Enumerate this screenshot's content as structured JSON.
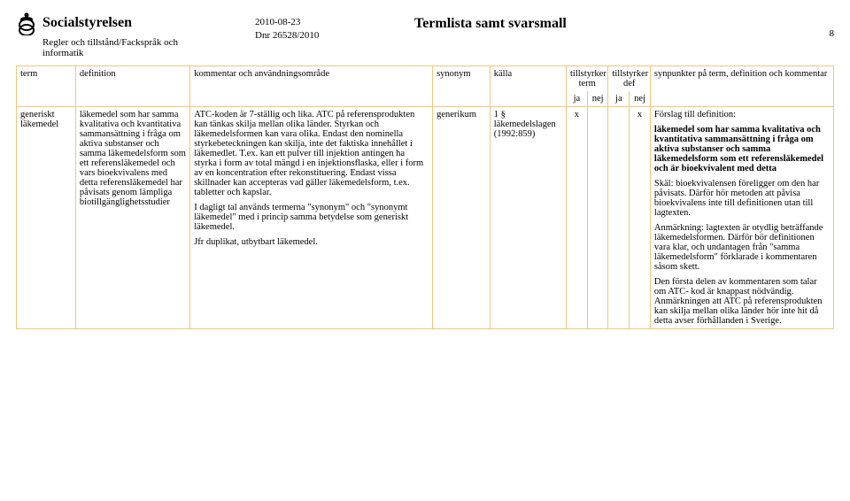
{
  "header": {
    "agency": "Socialstyrelsen",
    "subunit": "Regler och tillstånd/Fackspråk och informatik",
    "date": "2010-08-23",
    "dnr": "Dnr 26528/2010",
    "title": "Termlista samt svarsmall",
    "page": "8"
  },
  "columns": {
    "term": "term",
    "definition": "definition",
    "kommentar": "kommentar och användningsområde",
    "synonym": "synonym",
    "kalla": "källa",
    "tillstyrker_term": "tillstyrker term",
    "tillstyrker_def": "tillstyrker def",
    "ja1": "ja",
    "nej1": "nej",
    "ja2": "ja",
    "nej2": "nej",
    "synpunkter": "synpunkter på term, definition och kommentar"
  },
  "row": {
    "term": "generiskt läkemedel",
    "definition": "läkemedel som har samma kvalitativa och kvantitativa sammansättning i fråga om aktiva substanser och samma läkemedelsform som ett referensläkemedel och vars bioekvivalens med detta referensläkemedel har påvisats genom lämpliga biotillgänglighetsstudier",
    "kommentar_p1": "ATC-koden är 7-ställig och lika. ATC på referensprodukten kan tänkas skilja mellan olika länder. Styrkan och läkemedelsformen kan vara olika. Endast den nominella styrkebeteckningen kan skilja, inte det faktiska innehållet i läkemedlet. T.ex. kan ett pulver till injektion antingen ha styrka i form av total mängd i en injektionsflaska, eller i form av en koncentration efter rekonstituering. Endast vissa skillnader kan accepteras vad gäller läkemedelsform, t.ex. tabletter och kapslar.",
    "kommentar_p2": "I dagligt tal används termerna \"synonym\" och \"synonymt läkemedel\" med i princip samma betydelse som generiskt läkemedel.",
    "kommentar_p3": "Jfr duplikat, utbytbart läkemedel.",
    "synonym": "generikum",
    "kalla": "1 § läkemedelslagen (1992:859)",
    "term_ja": "x",
    "term_nej": "",
    "def_ja": "",
    "def_nej": "x",
    "synpunkter_p1": "Förslag till definition:",
    "synpunkter_p2_bold": "läkemedel som har samma kvalitativa och kvantitativa sammansättning i fråga om aktiva substanser och samma läkemedelsform som ett referensläkemedel och är bioekvivalent med detta",
    "synpunkter_p3": "Skäl: bioekvivalensen föreligger om den har påvisats. Därför hör metoden att påvisa bioekvivalens inte till definitionen utan till lagtexten.",
    "synpunkter_p4": "Anmärkning: lagtexten är otydlig beträffande läkemedelsformen. Därför bör definitionen vara klar, och undantagen från \"samma läkemedelsform\" förklarade i kommentaren såsom skett.",
    "synpunkter_p5": "Den första delen av kommentaren som talar om ATC- kod är knappast nödvändig. Anmärkningen att ATC på referensprodukten kan skilja mellan olika länder hör inte hit då detta avser förhållanden i Sverige."
  }
}
